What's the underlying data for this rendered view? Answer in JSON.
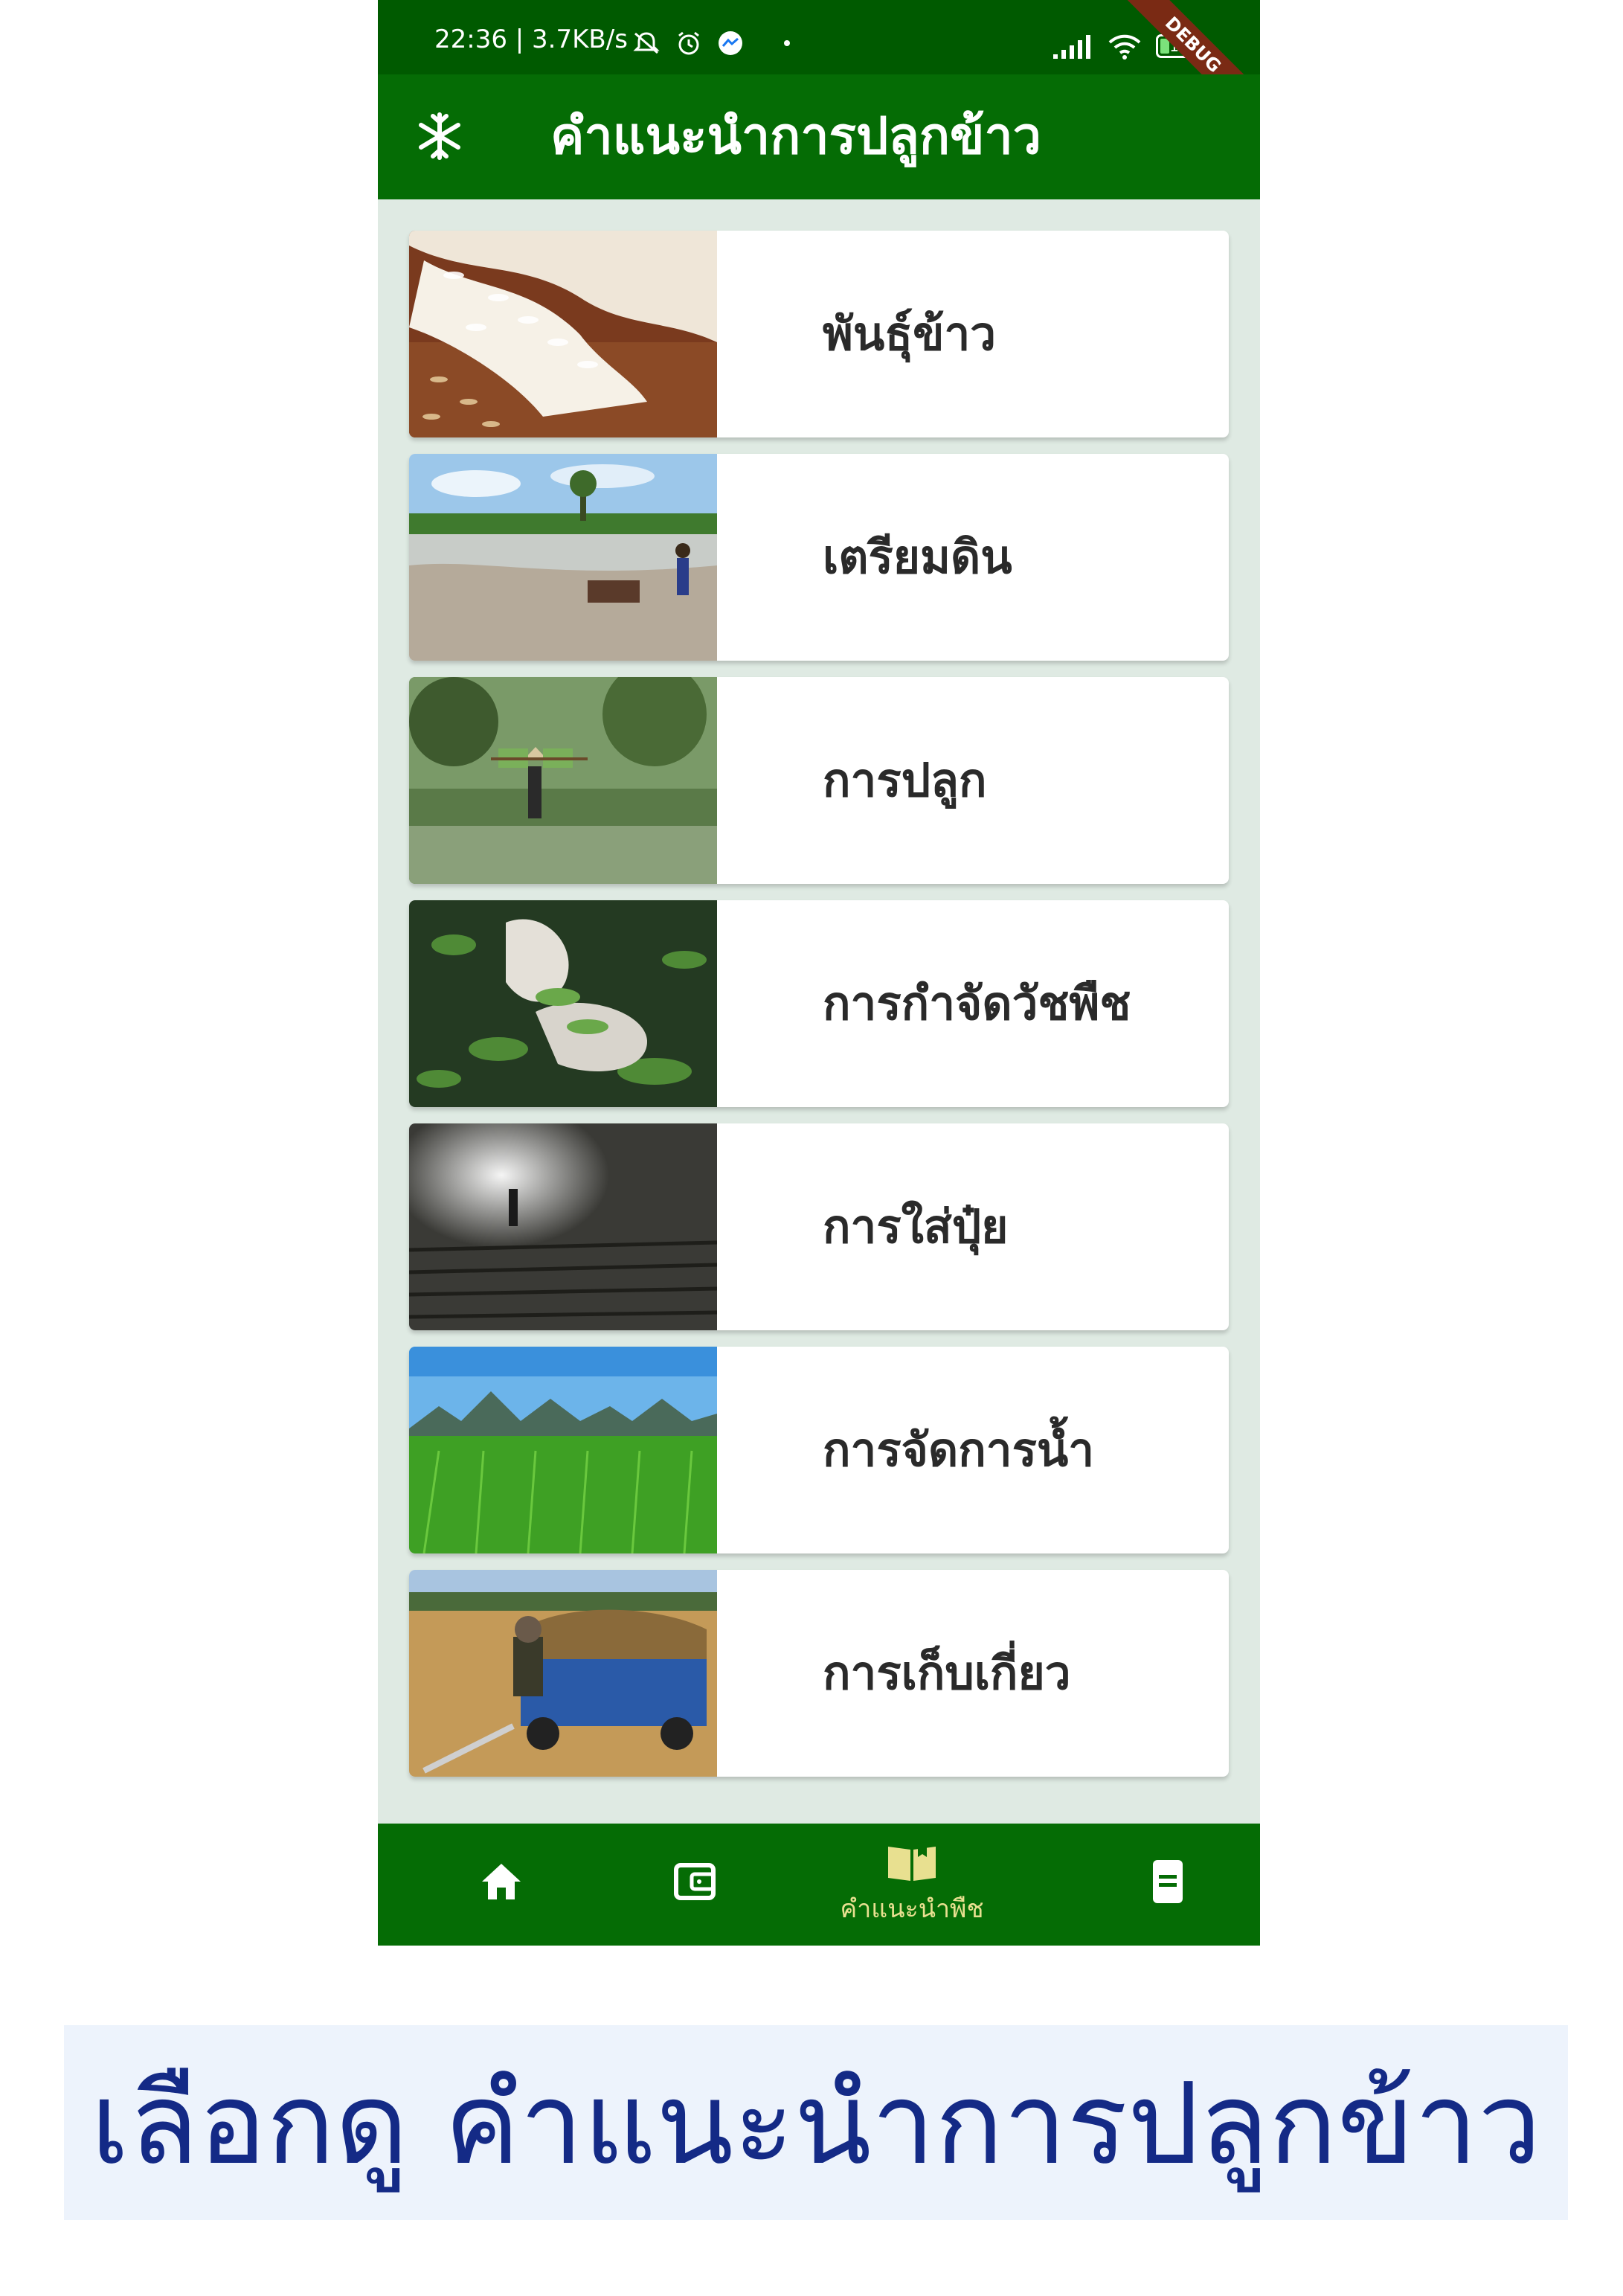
{
  "status_bar": {
    "time": "22:36 | 3.7KB/s",
    "battery_level": "19",
    "debug_banner": "DEBUG"
  },
  "app_bar": {
    "title": "คำแนะนำการปลูกข้าว",
    "icon": "snowflake-icon"
  },
  "menu_items": [
    {
      "label": "พันธุ์ข้าว",
      "image": "rice-grains-photo"
    },
    {
      "label": "เตรียมดิน",
      "image": "plowing-field-photo"
    },
    {
      "label": "การปลูก",
      "image": "planting-seedlings-photo"
    },
    {
      "label": "การกำจัดวัชพืช",
      "image": "pulling-weeds-photo"
    },
    {
      "label": "การใส่ปุ๋ย",
      "image": "fertilizer-spraying-photo"
    },
    {
      "label": "การจัดการน้ำ",
      "image": "rice-field-mountains-photo"
    },
    {
      "label": "การเก็บเกี่ยว",
      "image": "harvest-cart-photo"
    }
  ],
  "bottom_nav": {
    "items": [
      {
        "icon": "home-icon",
        "label": ""
      },
      {
        "icon": "wallet-icon",
        "label": ""
      },
      {
        "icon": "open-book-icon",
        "label": "คำแนะนำพืช"
      },
      {
        "icon": "document-icon",
        "label": ""
      }
    ],
    "active_color": "#e8e090",
    "inactive_color": "#ffffff"
  },
  "caption": {
    "text": "เลือกดู คำแนะนำการปลูกข้าว"
  },
  "colors": {
    "app_bar": "#056c05",
    "status_bar": "#005a00",
    "background": "#dfeae3",
    "caption_text": "#142a86",
    "caption_background": "#edf3fc"
  }
}
